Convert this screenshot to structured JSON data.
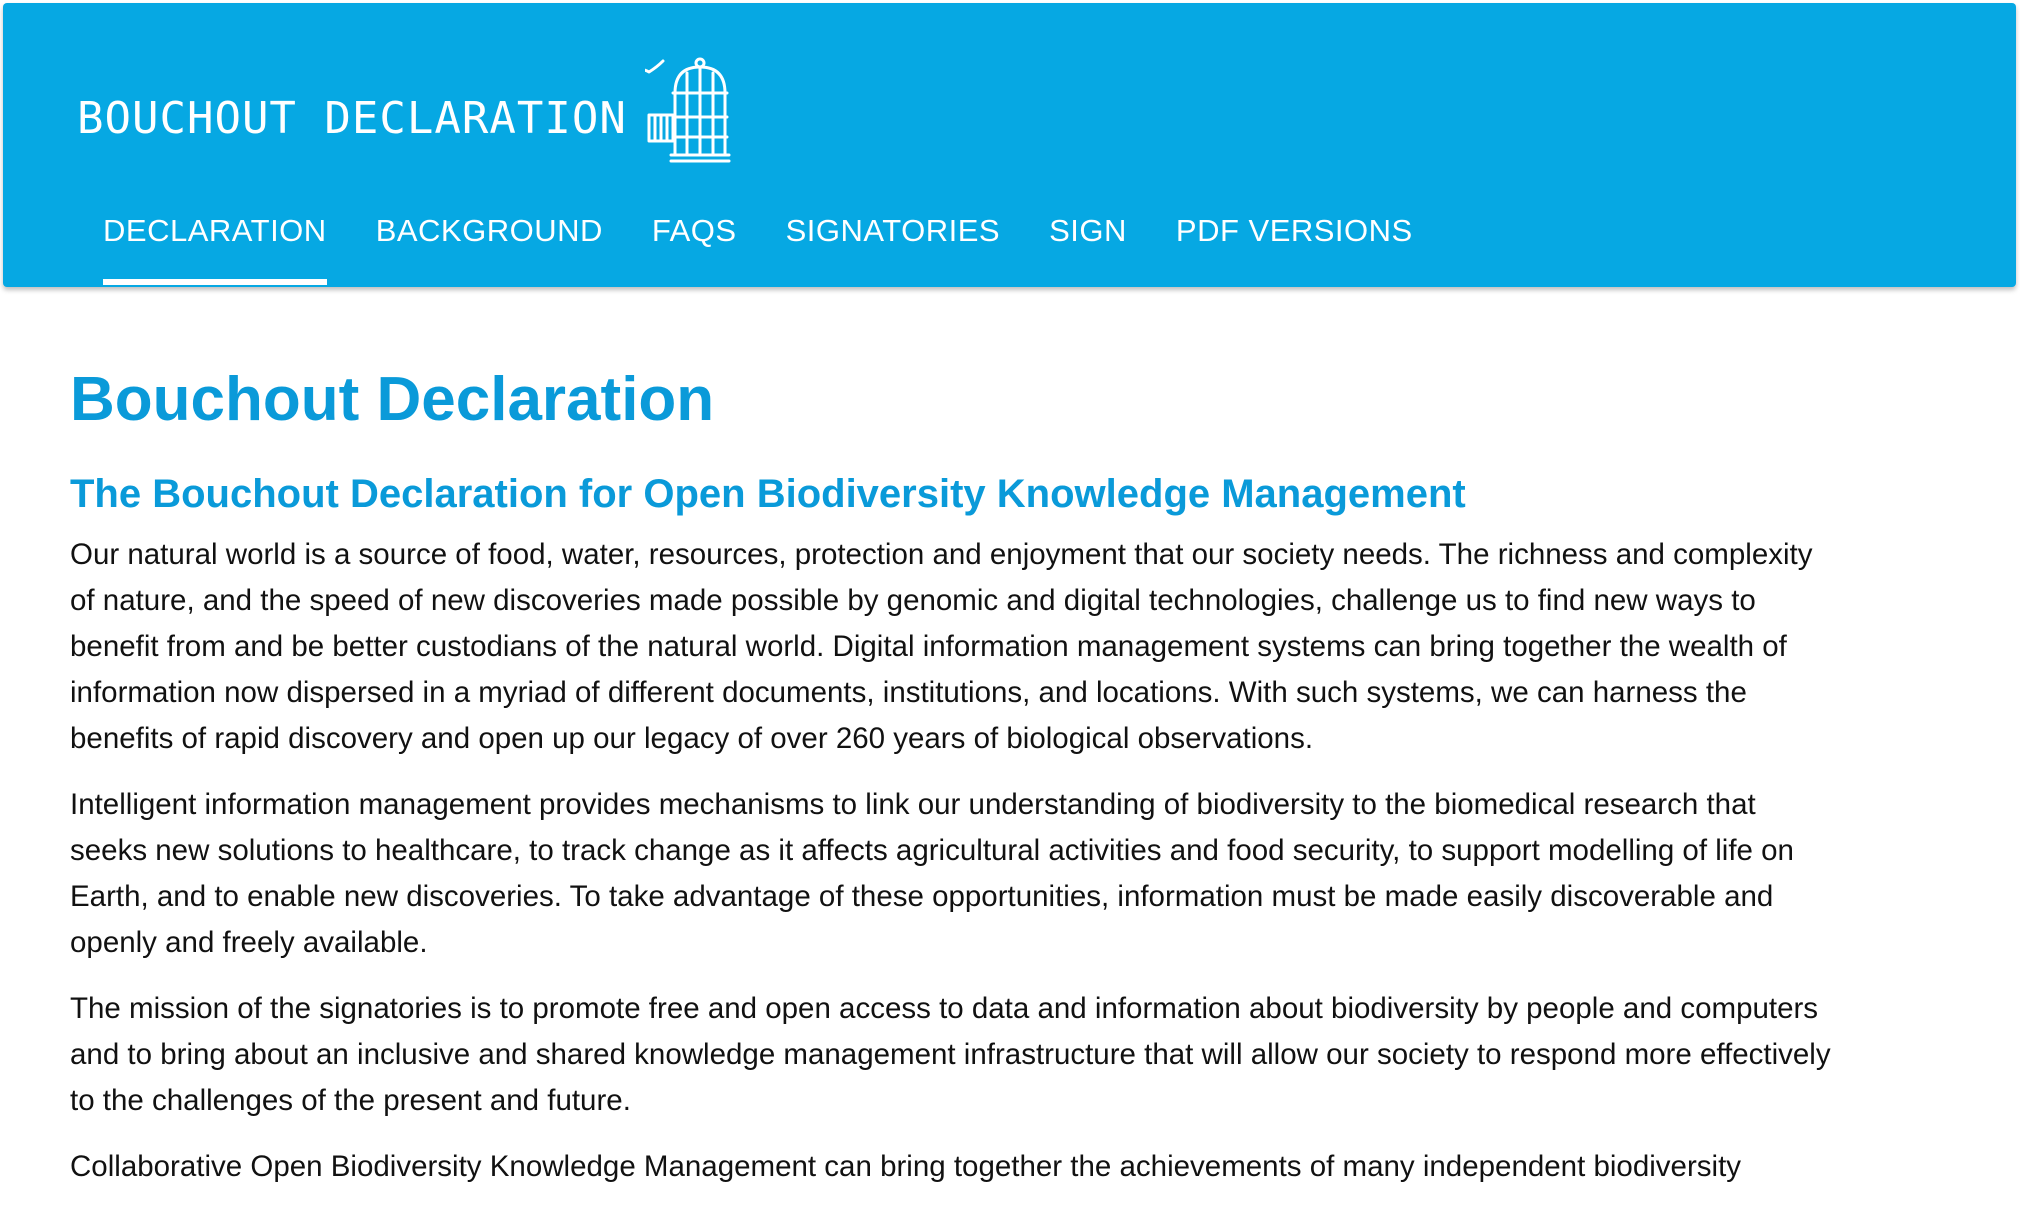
{
  "header": {
    "brand": "BOUCHOUT DECLARATION",
    "logo_icon": "birdcage-bird-icon",
    "background_color": "#06a8e3"
  },
  "nav": {
    "items": [
      {
        "label": "DECLARATION",
        "active": true
      },
      {
        "label": "BACKGROUND",
        "active": false
      },
      {
        "label": "FAQS",
        "active": false
      },
      {
        "label": "SIGNATORIES",
        "active": false
      },
      {
        "label": "SIGN",
        "active": false
      },
      {
        "label": "PDF VERSIONS",
        "active": false
      }
    ]
  },
  "main": {
    "title": "Bouchout Declaration",
    "subtitle": "The Bouchout Declaration for Open Biodiversity Knowledge Management",
    "paragraphs": [
      "Our natural world is a source of food, water, resources, protection and enjoyment that our society needs. The richness and complexity of nature, and the speed of new discoveries made possible by genomic and digital technologies, challenge us to find new ways to benefit from and be better custodians of the natural world. Digital information management systems can bring together the wealth of information now dispersed in a myriad of different documents, institutions, and locations. With such systems, we can harness the benefits of rapid discovery and open up our legacy of over 260 years of biological observations.",
      "Intelligent information management provides mechanisms to link our understanding of biodiversity to the biomedical research that seeks new solutions to healthcare, to track change as it affects agricultural activities and food security, to support modelling of life on Earth, and to enable new discoveries. To take advantage of these opportunities, information must be made easily discoverable and openly and freely available.",
      "The mission of the signatories is to promote free and open access to data and information about biodiversity by people and computers and to bring about an inclusive and shared knowledge management infrastructure that will allow our society to respond more effectively to the challenges of the present and future.",
      "Collaborative Open Biodiversity Knowledge Management can bring together the achievements of many independent biodiversity"
    ],
    "heading_color": "#0a9ad9"
  }
}
